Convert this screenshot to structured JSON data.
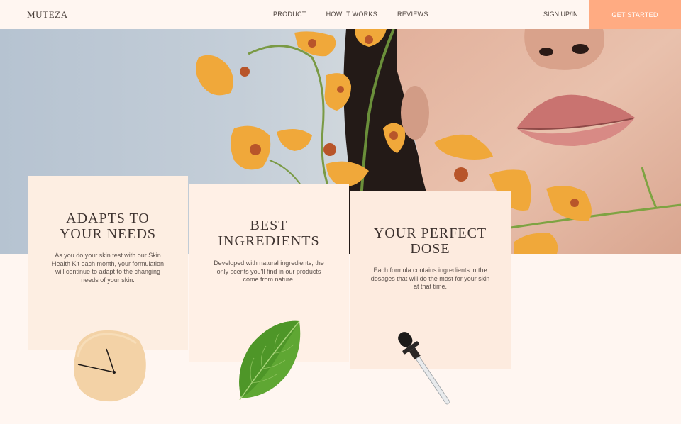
{
  "brand": {
    "logo": "MUTEZA"
  },
  "nav": {
    "links": [
      "PRODUCT",
      "HOW IT WORKS",
      "REVIEWS"
    ],
    "signup": "SIGN UP/IN",
    "cta": "GET STARTED"
  },
  "features": [
    {
      "title_line1": "ADAPTS TO",
      "title_line2": "YOUR NEEDS",
      "body": "As you do your skin test with our Skin Health Kit each month, your formulation will continue to adapt to the changing needs of your skin."
    },
    {
      "title_line1": "BEST",
      "title_line2": "INGREDIENTS",
      "body": "Developed with natural ingredients, the only scents you'll find in our products come from nature."
    },
    {
      "title_line1": "YOUR PERFECT",
      "title_line2": "DOSE",
      "body": "Each formula contains ingredients in the dosages that will do the most for your skin at that time."
    }
  ],
  "icons": [
    "clock-icon",
    "leaf-icon",
    "dropper-icon"
  ],
  "colors": {
    "cta": "#ffab82",
    "background": "#fff6f1",
    "card": "#fdeee2"
  }
}
